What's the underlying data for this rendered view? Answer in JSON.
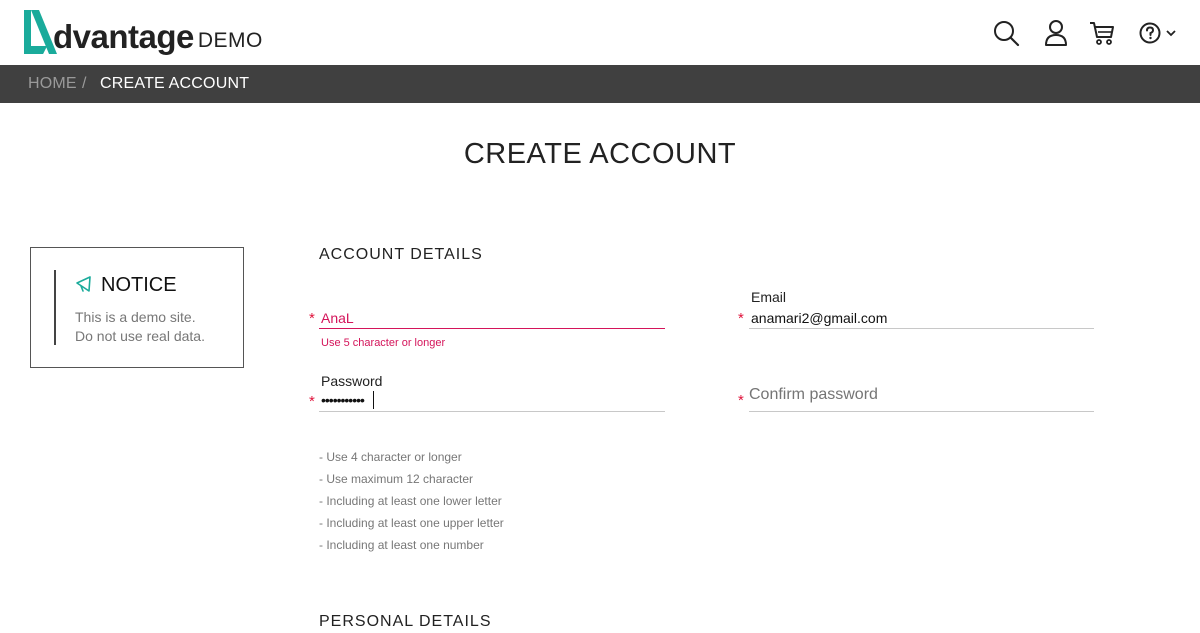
{
  "brand": {
    "logo_word": "dvantage",
    "logo_suffix": "DEMO",
    "accent": "#1aab9b"
  },
  "header": {
    "icons": [
      "search-icon",
      "user-icon",
      "cart-icon",
      "help-icon",
      "chevron-down-icon"
    ]
  },
  "breadcrumb": {
    "home": "HOME",
    "separator": "/",
    "current": "CREATE ACCOUNT"
  },
  "page_title": "CREATE ACCOUNT",
  "notice": {
    "title": "NOTICE",
    "line1": "This is a demo site.",
    "line2": "Do not use real data."
  },
  "account_details": {
    "title": "ACCOUNT DETAILS",
    "username": {
      "value": "AnaL",
      "error": "Use 5 character or longer"
    },
    "email": {
      "label": "Email",
      "value": "anamari2@gmail.com"
    },
    "password": {
      "label": "Password",
      "value": "•••••••••••"
    },
    "confirm_password": {
      "placeholder": "Confirm password"
    },
    "password_rules": [
      "- Use 4 character or longer",
      "- Use maximum 12 character",
      "- Including at least one lower letter",
      "- Including at least one upper letter",
      "- Including at least one number"
    ]
  },
  "personal_details": {
    "title": "PERSONAL DETAILS"
  },
  "colors": {
    "error": "#d4145a",
    "required": "#e0143c",
    "breadcrumb_bg": "#404040"
  }
}
